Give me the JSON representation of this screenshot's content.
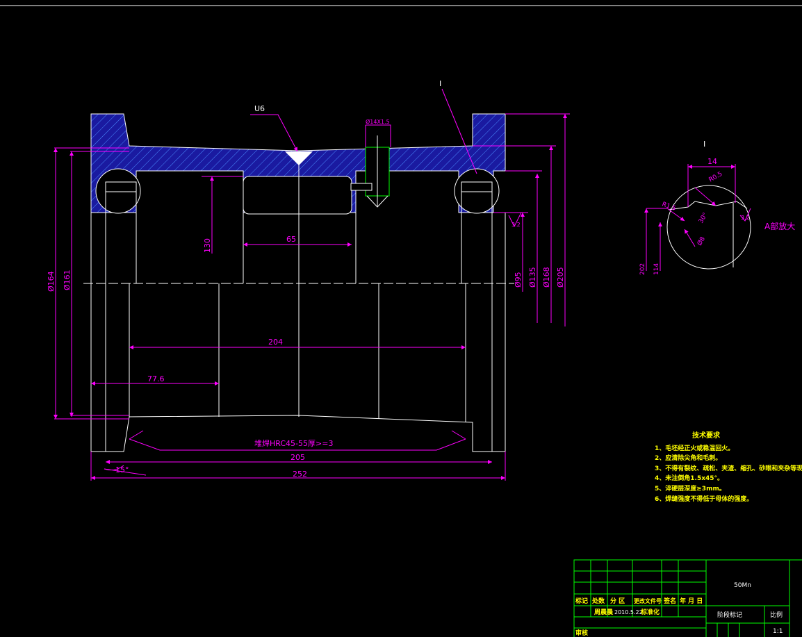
{
  "colors": {
    "background": "#000000",
    "outline": "#ffffff",
    "dimension": "#ff00ff",
    "hatch_fill": "#1a1aa0",
    "hatch_line": "#4a8cff",
    "table_grid": "#00ff00",
    "notes": "#ffff00",
    "thread": "#00ff00"
  },
  "labels": {
    "weld_mark": "U6",
    "detail_mark": "I",
    "detail_title": "I",
    "thread_callout": "Ø14X1.5",
    "surface_roughness": "3.2",
    "hardening_note": "堆焊HRC45-55厚>=3",
    "enlarge_note": "A部放大"
  },
  "dimensions": {
    "d_130": "130",
    "d_65": "65",
    "d_204": "204",
    "d_776": "77.6",
    "d_205": "205",
    "d_252": "252",
    "angle_15": "15°",
    "dia_164": "Ø164",
    "dia_161": "Ø161",
    "dia_95": "Ø95",
    "dia_135": "Ø135",
    "dia_168": "Ø168",
    "dia_205": "Ø205",
    "det_14": "14",
    "det_r05": "R0.5",
    "det_r15": "R1.5",
    "det_30": "30°",
    "det_202": "202",
    "det_114": "114",
    "det_32": "3.2",
    "det_small": "Ø8"
  },
  "tech_requirements": {
    "title": "技术要求",
    "items": [
      "1、毛坯经正火或稳温回火。",
      "2、应清除尖角和毛刺。",
      "3、不得有裂纹、疏松、夹渣、缩孔、砂眼和夹杂等现象。",
      "4、未注倒角1.5x45°。",
      "5、淬硬层深度≥3mm。",
      "6、焊缝强度不得低于母体的强度。"
    ]
  },
  "title_block": {
    "part_name": "50Mn",
    "header_row": [
      "标记",
      "处数",
      "分 区",
      "更改文件号",
      "签名",
      "年 月 日"
    ],
    "designer": "周晨晨",
    "date": "2010.5.22",
    "standardized": "标准化",
    "stage_mark": "阶段标记",
    "scale_label": "比例",
    "scale_value": "1:1",
    "review_label": "审核"
  }
}
